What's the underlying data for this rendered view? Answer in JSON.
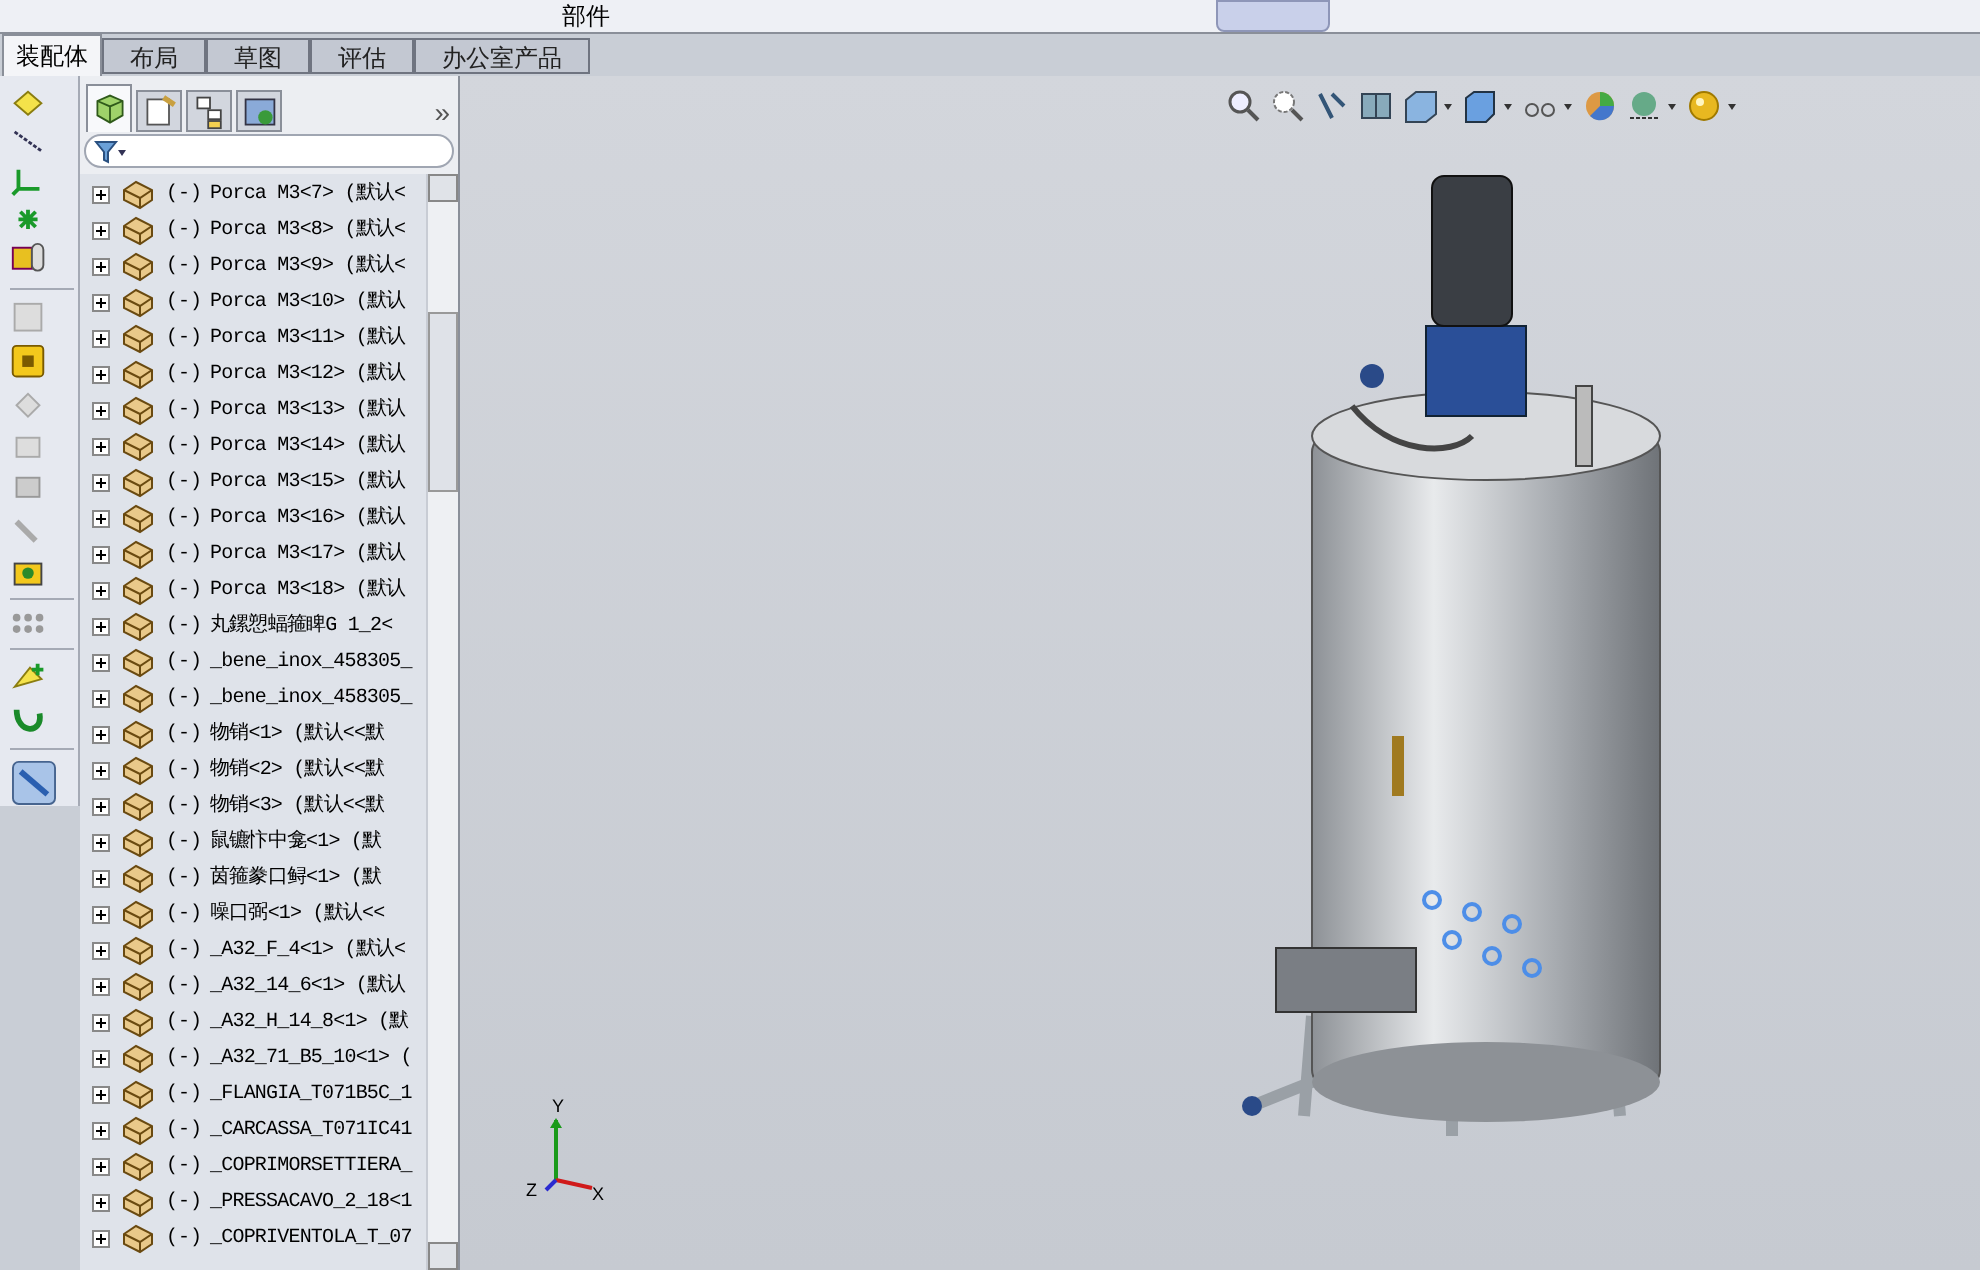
{
  "top_toolbar": {
    "label": "部件"
  },
  "command_tabs": [
    {
      "label": "装配体",
      "selected": true
    },
    {
      "label": "布局",
      "selected": false
    },
    {
      "label": "草图",
      "selected": false
    },
    {
      "label": "评估",
      "selected": false
    },
    {
      "label": "办公室产品",
      "selected": false
    }
  ],
  "manager_tabs": [
    {
      "kind": "feature",
      "selected": true
    },
    {
      "kind": "property",
      "selected": false
    },
    {
      "kind": "config",
      "selected": false
    },
    {
      "kind": "display",
      "selected": false
    }
  ],
  "manager_more": "»",
  "tree": {
    "items": [
      {
        "state": "(-)",
        "label": "Porca M3<7> (默认<"
      },
      {
        "state": "(-)",
        "label": "Porca M3<8> (默认<"
      },
      {
        "state": "(-)",
        "label": "Porca M3<9> (默认<"
      },
      {
        "state": "(-)",
        "label": "Porca M3<10> (默认"
      },
      {
        "state": "(-)",
        "label": "Porca M3<11> (默认"
      },
      {
        "state": "(-)",
        "label": "Porca M3<12> (默认"
      },
      {
        "state": "(-)",
        "label": "Porca M3<13> (默认"
      },
      {
        "state": "(-)",
        "label": "Porca M3<14> (默认"
      },
      {
        "state": "(-)",
        "label": "Porca M3<15> (默认"
      },
      {
        "state": "(-)",
        "label": "Porca M3<16> (默认"
      },
      {
        "state": "(-)",
        "label": "Porca M3<17> (默认"
      },
      {
        "state": "(-)",
        "label": "Porca M3<18> (默认"
      },
      {
        "state": "(-)",
        "label": "丸鏍愬蝠箍睥G 1_2<"
      },
      {
        "state": "(-)",
        "label": "_bene_inox_458305_"
      },
      {
        "state": "(-)",
        "label": "_bene_inox_458305_"
      },
      {
        "state": "(-)",
        "label": "物销<1> (默认<<默"
      },
      {
        "state": "(-)",
        "label": "物销<2> (默认<<默"
      },
      {
        "state": "(-)",
        "label": "物销<3> (默认<<默"
      },
      {
        "state": "(-)",
        "label": "鼠镳忭中龛<1> (默"
      },
      {
        "state": "(-)",
        "label": "茵箍豢口鲟<1> (默"
      },
      {
        "state": "(-)",
        "label": "噪口弼<1> (默认<<"
      },
      {
        "state": "(-)",
        "label": "_A32_F_4<1> (默认<"
      },
      {
        "state": "(-)",
        "label": "_A32_14_6<1> (默认"
      },
      {
        "state": "(-)",
        "label": "_A32_H_14_8<1> (默"
      },
      {
        "state": "(-)",
        "label": "_A32_71_B5_10<1> ("
      },
      {
        "state": "(-)",
        "label": "_FLANGIA_T071B5C_1"
      },
      {
        "state": "(-)",
        "label": "_CARCASSA_T071IC41"
      },
      {
        "state": "(-)",
        "label": "_COPRIMORSETTIERA_"
      },
      {
        "state": "(-)",
        "label": "_PRESSACAVO_2_18<1"
      },
      {
        "state": "(-)",
        "label": "_COPRIVENTOLA_T_07"
      }
    ]
  },
  "triad": {
    "y": "Y",
    "z": "Z",
    "x": "X"
  }
}
